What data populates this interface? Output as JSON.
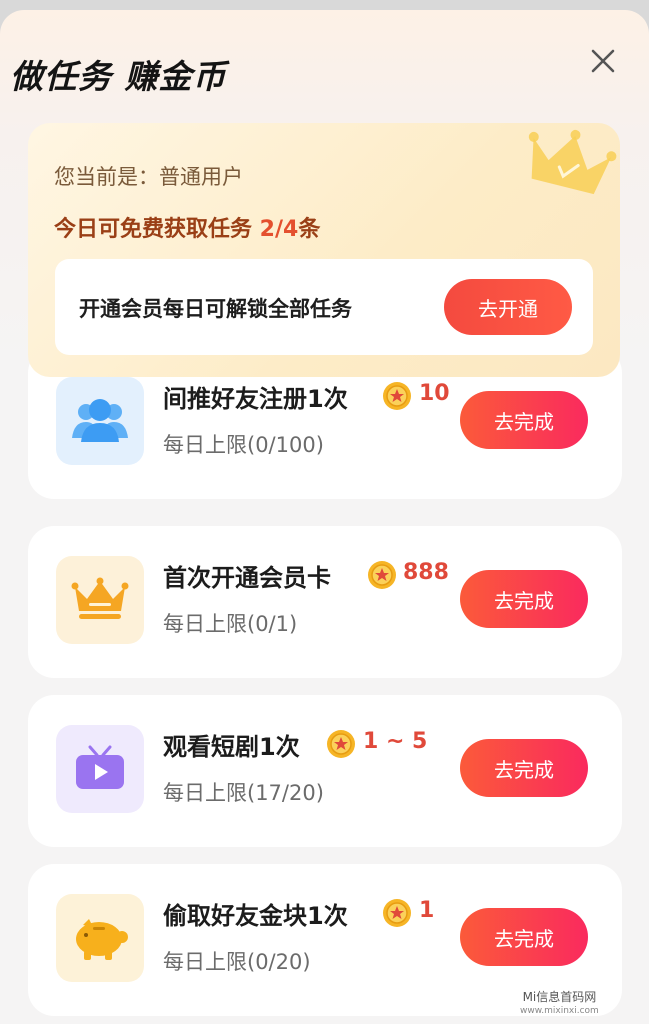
{
  "header": {
    "title": "做任务 赚金币",
    "close_icon": "close-icon"
  },
  "member": {
    "status_prefix": "您当前是：",
    "status_value": "普通用户",
    "quota_prefix": "今日可免费获取任务 ",
    "quota_value": "2/4",
    "quota_suffix": "条",
    "promo_text": "开通会员每日可解锁全部任务",
    "open_button": "去开通",
    "decoration_icon": "crown-icon"
  },
  "tasks": [
    {
      "title": "间推好友注册1次",
      "reward": "10",
      "limit": "每日上限(0/100)",
      "button": "去完成",
      "icon": "users-icon",
      "icon_bg": "#e3f0fd",
      "icon_color": "#3d9cf3"
    },
    {
      "title": "首次开通会员卡",
      "reward": "888",
      "limit": "每日上限(0/1)",
      "button": "去完成",
      "icon": "crown-icon",
      "icon_bg": "#fdf1d9",
      "icon_color": "#f5a623"
    },
    {
      "title": "观看短剧1次",
      "reward": "1 ~ 5",
      "limit": "每日上限(17/20)",
      "button": "去完成",
      "icon": "tv-icon",
      "icon_bg": "#efeafd",
      "icon_color": "#9a74f0"
    },
    {
      "title": "偷取好友金块1次",
      "reward": "1",
      "limit": "每日上限(0/20)",
      "button": "去完成",
      "icon": "piggy-bank-icon",
      "icon_bg": "#fdf2d8",
      "icon_color": "#f7b01c"
    }
  ],
  "colors": {
    "accent_red": "#e0493a",
    "button_gradient_start": "#fb5a3a",
    "button_gradient_end": "#fa2a5e",
    "quota_text": "#9a3f16"
  },
  "watermark": {
    "line1": "Mi信息首码网",
    "line2": "www.mixinxi.com"
  }
}
